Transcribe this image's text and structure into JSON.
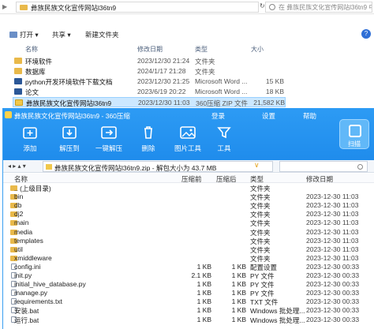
{
  "explorer": {
    "path": "彝族民族文化宣传网站l36tn9",
    "nav": "▶",
    "search_placeholder": "在 彝族民族文化宣传网站l36tn9 中搜索",
    "toolbar": [
      {
        "label": "打开 ▾"
      },
      {
        "label": "共享 ▾"
      },
      {
        "label": "新建文件夹"
      }
    ],
    "help": "?",
    "columns": {
      "name": "名称",
      "date": "修改日期",
      "type": "类型",
      "size": "大小"
    },
    "files": [
      {
        "name": "环境软件",
        "date": "2023/12/30 21:24",
        "type": "文件夹",
        "size": "",
        "icon": "folder"
      },
      {
        "name": "数据库",
        "date": "2024/1/17 21:28",
        "type": "文件夹",
        "size": "",
        "icon": "folder"
      },
      {
        "name": "python开发环境软件下载文档",
        "date": "2023/12/30 21:25",
        "type": "Microsoft Word ...",
        "size": "15 KB",
        "icon": "word"
      },
      {
        "name": "论文",
        "date": "2023/6/19 20:22",
        "type": "Microsoft Word ...",
        "size": "18 KB",
        "icon": "word"
      },
      {
        "name": "彝族民族文化宣传网站l36tn9",
        "date": "2023/12/30 11:03",
        "type": "360压缩 ZIP 文件",
        "size": "21,582 KB",
        "icon": "zip",
        "selected": true
      }
    ]
  },
  "zip": {
    "title": "彝族民族文化宣传网站l36tn9 - 360压缩",
    "menu": [
      "登录",
      "设置",
      "帮助"
    ],
    "tools": [
      {
        "label": "添加",
        "icon": "add-icon"
      },
      {
        "label": "解压到",
        "icon": "extract-icon"
      },
      {
        "label": "一键解压",
        "icon": "one-click-extract-icon"
      },
      {
        "label": "删除",
        "icon": "delete-icon"
      },
      {
        "label": "图片工具",
        "icon": "image-tool-icon"
      },
      {
        "label": "工具",
        "icon": "tools-icon"
      }
    ],
    "scan_label": "扫描",
    "nav": "◂ ▸ ▴ ▾",
    "path": "彝族民族文化宣传网站l36tn9.zip - 解包大小为 43.7 MB",
    "columns": {
      "name": "名称",
      "size": "压缩前",
      "packed": "压缩后",
      "type": "类型",
      "date": "修改日期"
    },
    "files": [
      {
        "name": ".. (上级目录)",
        "size": "",
        "packed": "",
        "type": "文件夹",
        "date": "",
        "icon": "folder"
      },
      {
        "name": "bin",
        "size": "",
        "packed": "",
        "type": "文件夹",
        "date": "2023-12-30 11:03",
        "icon": "folder"
      },
      {
        "name": "db",
        "size": "",
        "packed": "",
        "type": "文件夹",
        "date": "2023-12-30 11:03",
        "icon": "folder"
      },
      {
        "name": "dj2",
        "size": "",
        "packed": "",
        "type": "文件夹",
        "date": "2023-12-30 11:03",
        "icon": "folder"
      },
      {
        "name": "main",
        "size": "",
        "packed": "",
        "type": "文件夹",
        "date": "2023-12-30 11:03",
        "icon": "folder"
      },
      {
        "name": "media",
        "size": "",
        "packed": "",
        "type": "文件夹",
        "date": "2023-12-30 11:03",
        "icon": "folder"
      },
      {
        "name": "templates",
        "size": "",
        "packed": "",
        "type": "文件夹",
        "date": "2023-12-30 11:03",
        "icon": "folder"
      },
      {
        "name": "util",
        "size": "",
        "packed": "",
        "type": "文件夹",
        "date": "2023-12-30 11:03",
        "icon": "folder"
      },
      {
        "name": "xmiddleware",
        "size": "",
        "packed": "",
        "type": "文件夹",
        "date": "2023-12-30 11:03",
        "icon": "folder"
      },
      {
        "name": "config.ini",
        "size": "1 KB",
        "packed": "1 KB",
        "type": "配置设置",
        "date": "2023-12-30 00:33",
        "icon": "file"
      },
      {
        "name": "init.py",
        "size": "2.1 KB",
        "packed": "1 KB",
        "type": "PY 文件",
        "date": "2023-12-30 00:33",
        "icon": "file"
      },
      {
        "name": "initial_hive_database.py",
        "size": "1 KB",
        "packed": "1 KB",
        "type": "PY 文件",
        "date": "2023-12-30 00:33",
        "icon": "file"
      },
      {
        "name": "manage.py",
        "size": "1 KB",
        "packed": "1 KB",
        "type": "PY 文件",
        "date": "2023-12-30 00:33",
        "icon": "file"
      },
      {
        "name": "requirements.txt",
        "size": "1 KB",
        "packed": "1 KB",
        "type": "TXT 文件",
        "date": "2023-12-30 00:33",
        "icon": "file"
      },
      {
        "name": "安装.bat",
        "size": "1 KB",
        "packed": "1 KB",
        "type": "Windows 批处理...",
        "date": "2023-12-30 00:33",
        "icon": "file"
      },
      {
        "name": "运行.bat",
        "size": "1 KB",
        "packed": "1 KB",
        "type": "Windows 批处理...",
        "date": "2023-12-30 00:33",
        "icon": "file"
      }
    ]
  },
  "colors": {
    "zip_blue": "#1f8cec",
    "selection": "#cce8ff",
    "folder": "#e9b94a"
  }
}
